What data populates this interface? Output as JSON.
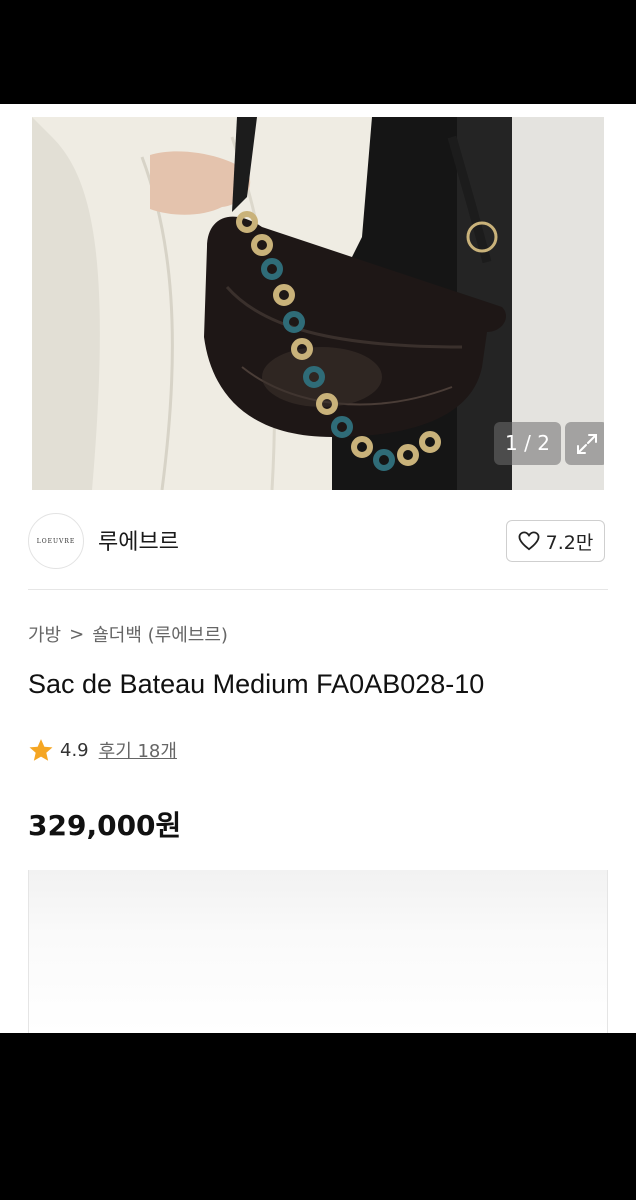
{
  "gallery": {
    "counter": "1 / 2"
  },
  "seller": {
    "logo_text": "LOEUVRE",
    "name": "루에브르",
    "likes": "7.2만"
  },
  "breadcrumb": {
    "category": "가방",
    "separator": ">",
    "subcategory": "숄더백 (루에브르)"
  },
  "product": {
    "title": "Sac de Bateau Medium FA0AB028-10",
    "rating": "4.9",
    "reviews": "후기 18개",
    "price": "329,000원"
  },
  "colors": {
    "star": "#f5a623",
    "text": "#111111",
    "muted": "#666666"
  }
}
